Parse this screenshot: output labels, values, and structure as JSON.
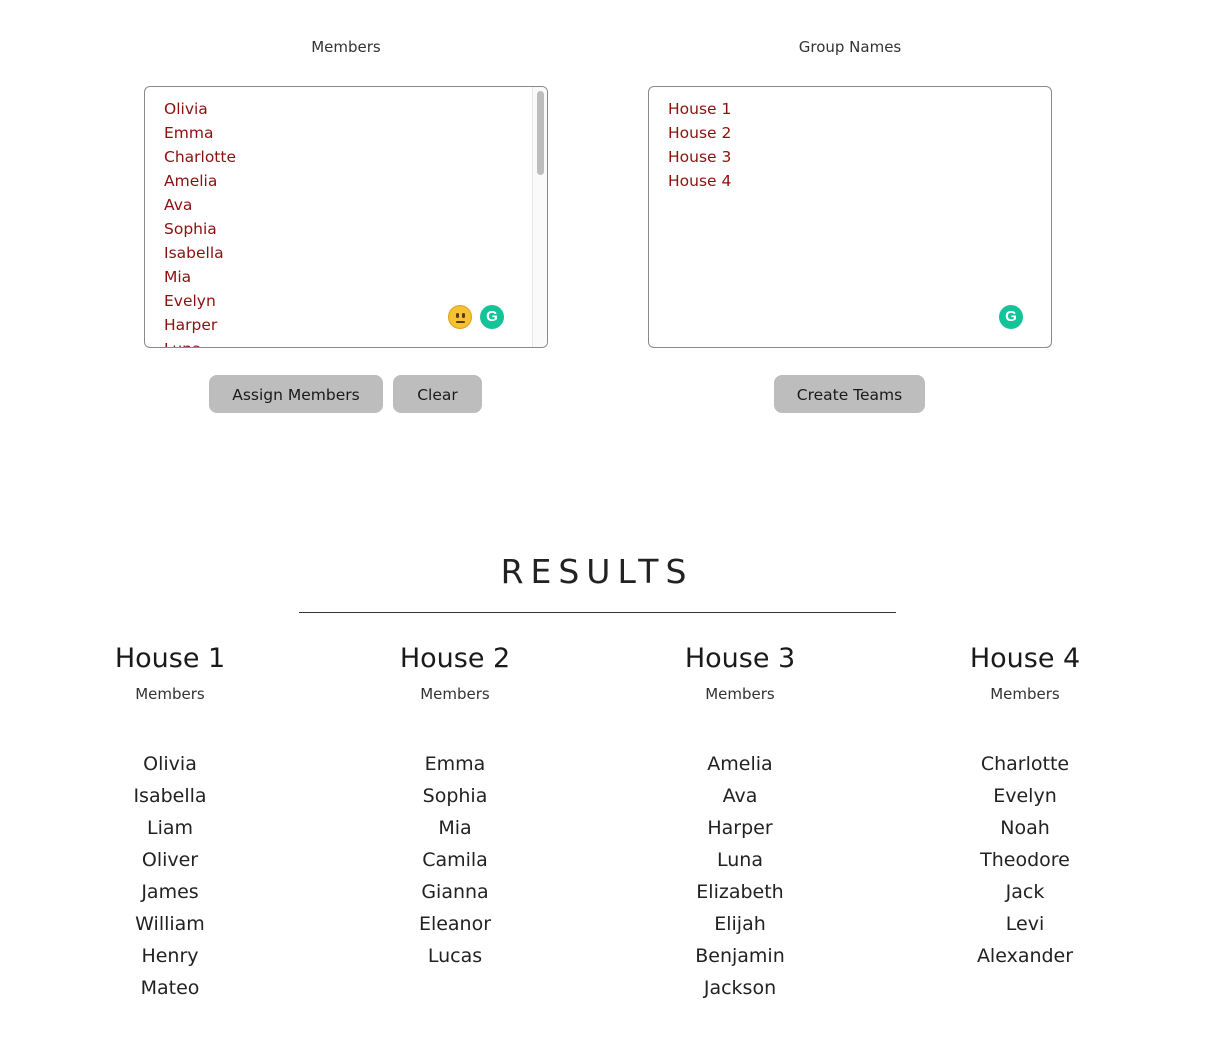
{
  "members_panel": {
    "label": "Members",
    "entries": [
      "Olivia",
      "Emma",
      "Charlotte",
      "Amelia",
      "Ava",
      "Sophia",
      "Isabella",
      "Mia",
      "Evelyn",
      "Harper",
      "Luna"
    ]
  },
  "groups_panel": {
    "label": "Group Names",
    "entries": [
      "House 1",
      "House 2",
      "House 3",
      "House 4"
    ]
  },
  "buttons": {
    "assign": "Assign Members",
    "clear": "Clear",
    "create": "Create Teams"
  },
  "results": {
    "title": "RESULTS",
    "teams": [
      {
        "name": "House 1",
        "sub": "Members",
        "members": [
          "Olivia",
          "Isabella",
          "Liam",
          "Oliver",
          "James",
          "William",
          "Henry",
          "Mateo"
        ]
      },
      {
        "name": "House 2",
        "sub": "Members",
        "members": [
          "Emma",
          "Sophia",
          "Mia",
          "Camila",
          "Gianna",
          "Eleanor",
          "Lucas"
        ]
      },
      {
        "name": "House 3",
        "sub": "Members",
        "members": [
          "Amelia",
          "Ava",
          "Harper",
          "Luna",
          "Elizabeth",
          "Elijah",
          "Benjamin",
          "Jackson"
        ]
      },
      {
        "name": "House 4",
        "sub": "Members",
        "members": [
          "Charlotte",
          "Evelyn",
          "Noah",
          "Theodore",
          "Jack",
          "Levi",
          "Alexander"
        ]
      }
    ]
  },
  "icons": {
    "grammar_icon": "G",
    "emoji_icon": "neutral-face-icon"
  },
  "colors": {
    "entry_text": "#8b1010",
    "button_bg": "#bdbdbd",
    "grammar_green": "#15c39a"
  }
}
